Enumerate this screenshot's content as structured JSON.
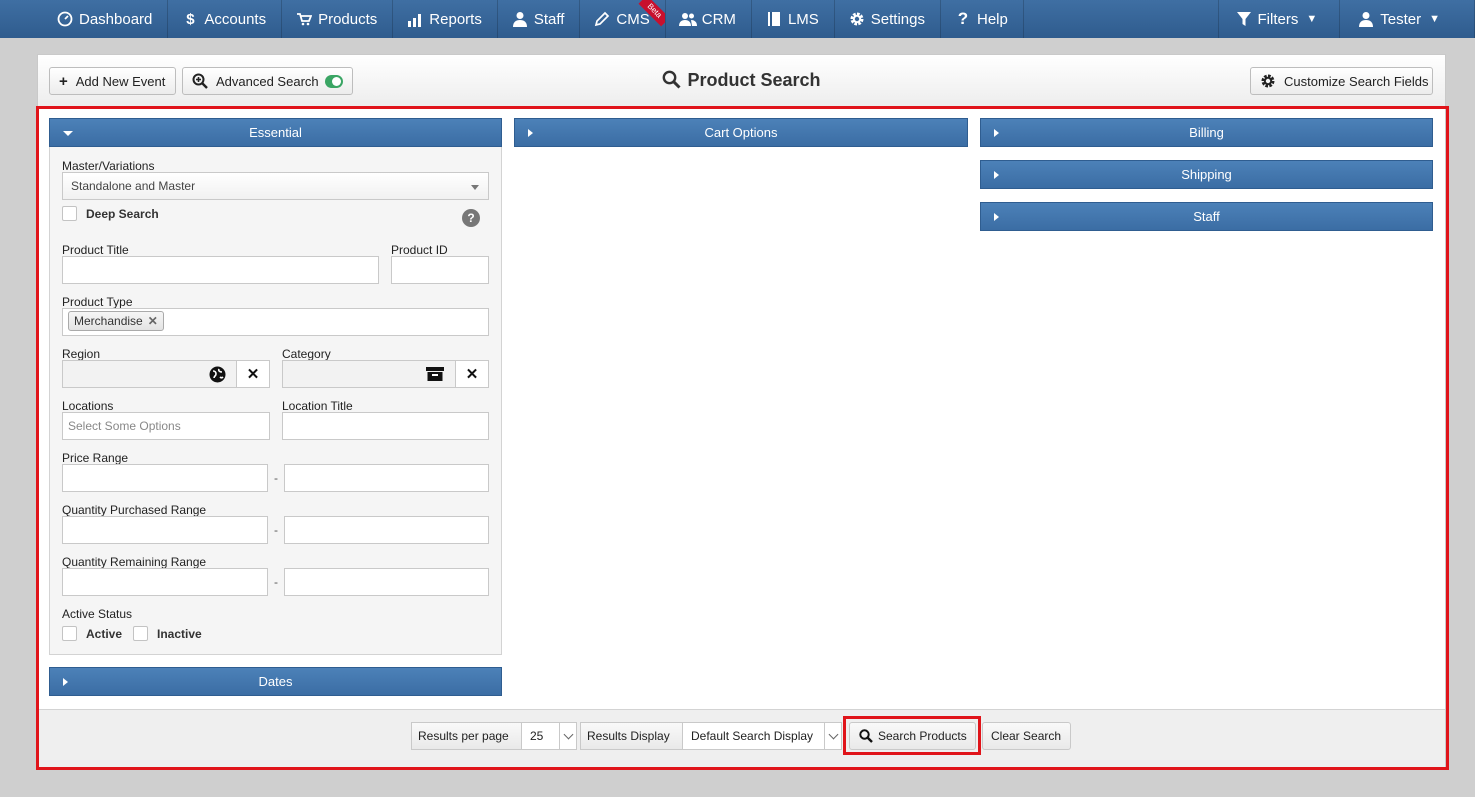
{
  "nav": {
    "items": [
      {
        "label": "Dashboard",
        "icon": "dashboard-icon"
      },
      {
        "label": "Accounts",
        "icon": "dollar-icon"
      },
      {
        "label": "Products",
        "icon": "cart-icon"
      },
      {
        "label": "Reports",
        "icon": "bar-chart-icon"
      },
      {
        "label": "Staff",
        "icon": "person-icon"
      },
      {
        "label": "CMS",
        "icon": "pencil-icon",
        "badge": "Beta"
      },
      {
        "label": "CRM",
        "icon": "people-icon"
      },
      {
        "label": "LMS",
        "icon": "book-icon"
      },
      {
        "label": "Settings",
        "icon": "gear-icon"
      },
      {
        "label": "Help",
        "icon": "question-icon"
      }
    ],
    "filters_label": "Filters",
    "user_label": "Tester"
  },
  "header": {
    "add_event_label": "Add New Event",
    "advanced_search_label": "Advanced Search",
    "advanced_search_on": true,
    "title": "Product Search",
    "customize_label": "Customize Search Fields"
  },
  "sections": {
    "essential": "Essential",
    "cart_options": "Cart Options",
    "billing": "Billing",
    "shipping": "Shipping",
    "staff": "Staff",
    "dates": "Dates"
  },
  "essential": {
    "master_variations_label": "Master/Variations",
    "master_variations_value": "Standalone and Master",
    "deep_search_label": "Deep Search",
    "help_glyph": "?",
    "product_title_label": "Product Title",
    "product_title_value": "",
    "product_id_label": "Product ID",
    "product_id_value": "",
    "product_type_label": "Product Type",
    "product_type_tag": "Merchandise",
    "region_label": "Region",
    "category_label": "Category",
    "locations_label": "Locations",
    "locations_placeholder": "Select Some Options",
    "location_title_label": "Location Title",
    "price_range_label": "Price Range",
    "qty_purchased_label": "Quantity Purchased Range",
    "qty_remaining_label": "Quantity Remaining Range",
    "range_separator": "-",
    "active_status_label": "Active Status",
    "active_label": "Active",
    "inactive_label": "Inactive"
  },
  "footer": {
    "results_per_page_label": "Results per page",
    "results_per_page_value": "25",
    "results_display_label": "Results Display",
    "results_display_value": "Default Search Display",
    "search_button_label": "Search Products",
    "clear_button_label": "Clear Search"
  },
  "colors": {
    "nav_bg": "#3a699c",
    "accordion_bg": "#4377ae",
    "highlight": "#e0141a",
    "toggle_on": "#3aa564"
  }
}
